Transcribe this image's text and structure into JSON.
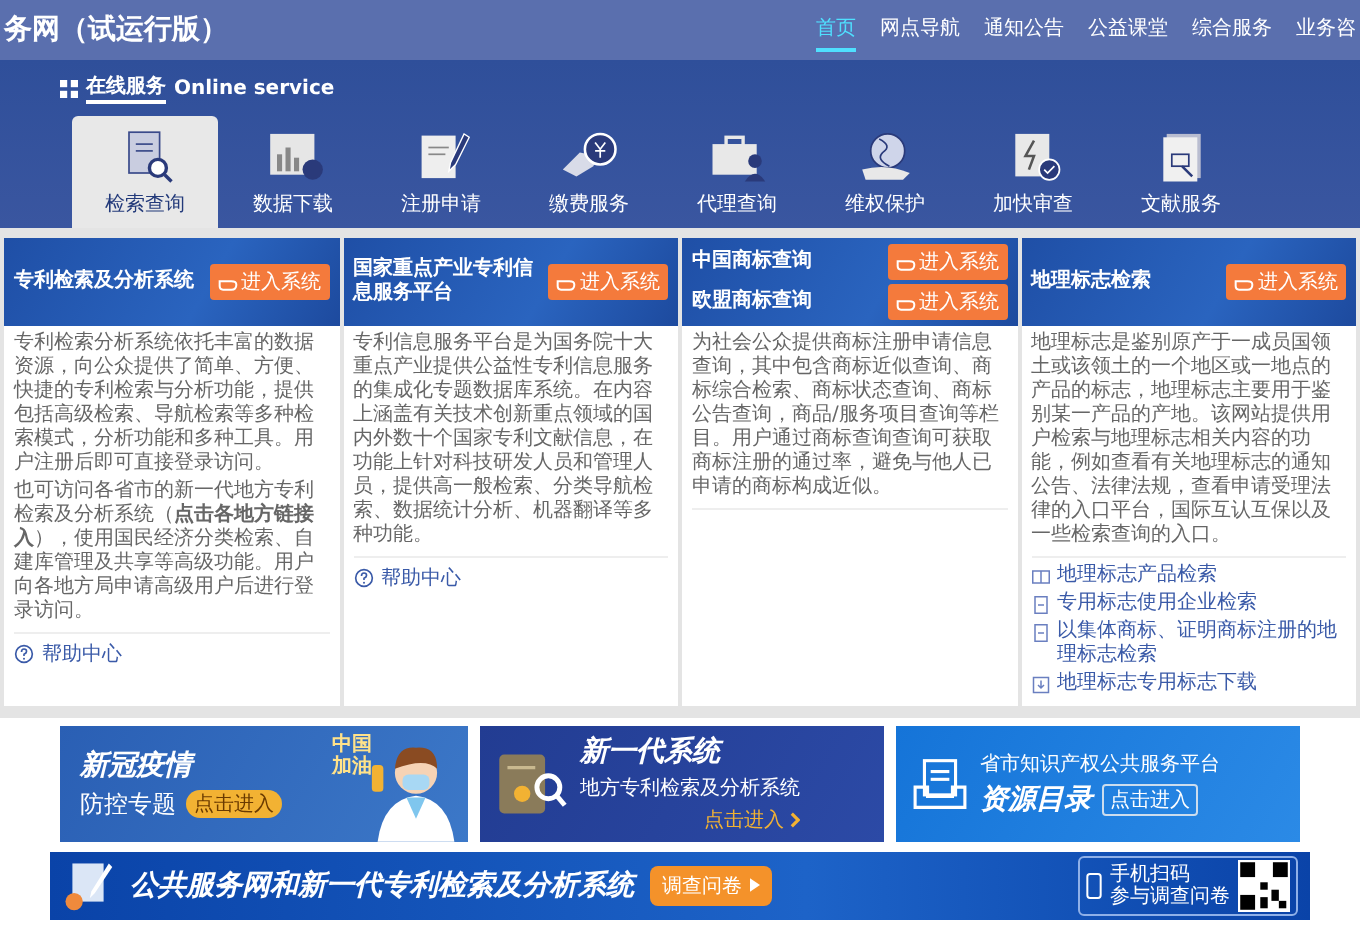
{
  "header": {
    "title": "务网（试运行版）",
    "nav": [
      {
        "label": "首页",
        "selected": true
      },
      {
        "label": "网点导航",
        "selected": false
      },
      {
        "label": "通知公告",
        "selected": false
      },
      {
        "label": "公益课堂",
        "selected": false
      },
      {
        "label": "综合服务",
        "selected": false
      },
      {
        "label": "业务咨",
        "selected": false
      }
    ]
  },
  "services": {
    "title": "在线服务",
    "subtitle": "Online service",
    "items": [
      {
        "label": "检索查询",
        "selected": true
      },
      {
        "label": "数据下载",
        "selected": false
      },
      {
        "label": "注册申请",
        "selected": false
      },
      {
        "label": "缴费服务",
        "selected": false
      },
      {
        "label": "代理查询",
        "selected": false
      },
      {
        "label": "维权保护",
        "selected": false
      },
      {
        "label": "加快审查",
        "selected": false
      },
      {
        "label": "文献服务",
        "selected": false
      }
    ]
  },
  "cards": [
    {
      "entries": [
        {
          "title": "专利检索及分析系统",
          "button": "进入系统"
        }
      ],
      "paragraphs": [
        "专利检索分析系统依托丰富的数据资源，向公众提供了简单、方便、快捷的专利检索与分析功能，提供包括高级检索、导航检索等多种检索模式，分析功能和多种工具。用户注册后即可直接登录访问。",
        "也可访问各省市的新一代地方专利检索及分析系统（**点击各地方链接入**），使用国民经济分类检索、自建库管理及共享等高级功能。用户向各地方局申请高级用户后进行登录访问。"
      ],
      "help": "帮助中心"
    },
    {
      "entries": [
        {
          "title": "国家重点产业专利信息服务平台",
          "button": "进入系统"
        }
      ],
      "paragraphs": [
        "专利信息服务平台是为国务院十大重点产业提供公益性专利信息服务的集成化专题数据库系统。在内容上涵盖有关技术创新重点领域的国内外数十个国家专利文献信息，在功能上针对科技研发人员和管理人员，提供高一般检索、分类导航检索、数据统计分析、机器翻译等多种功能。"
      ],
      "help": "帮助中心"
    },
    {
      "entries": [
        {
          "title": "中国商标查询",
          "button": "进入系统"
        },
        {
          "title": "欧盟商标查询",
          "button": "进入系统"
        }
      ],
      "paragraphs": [
        "为社会公众提供商标注册申请信息查询，其中包含商标近似查询、商标综合检索、商标状态查询、商标公告查询，商品/服务项目查询等栏目。用户通过商标查询查询可获取商标注册的通过率，避免与他人已申请的商标构成近似。"
      ]
    },
    {
      "entries": [
        {
          "title": "地理标志检索",
          "button": "进入系统"
        }
      ],
      "paragraphs": [
        "地理标志是鉴别原产于一成员国领土或该领土的一个地区或一地点的产品的标志，地理标志主要用于鉴别某一产品的产地。该网站提供用户检索与地理标志相关内容的功能，例如查看有关地理标志的通知公告、法律法规，查看申请受理法律的入口平台，国际互认互保以及一些检索查询的入口。"
      ],
      "links": [
        {
          "kind": "search",
          "label": "地理标志产品检索"
        },
        {
          "kind": "doc",
          "label": "专用标志使用企业检索"
        },
        {
          "kind": "doc",
          "label": "以集体商标、证明商标注册的地理标志检索"
        },
        {
          "kind": "download",
          "label": "地理标志专用标志下载"
        }
      ]
    }
  ],
  "banners": [
    {
      "kind": "epidemic",
      "title": "新冠疫情",
      "subtitle": "防控专题",
      "badge": "中国加油",
      "action": "点击进入"
    },
    {
      "kind": "system",
      "title": "新一代系统",
      "subtitle": "地方专利检索及分析系统",
      "action": "点击进入"
    },
    {
      "kind": "catalog",
      "title": "省市知识产权公共服务平台",
      "subtitle": "资源目录",
      "action": "点击进入"
    }
  ],
  "survey": {
    "title": "公共服务网和新一代专利检索及分析系统",
    "button": "调查问卷",
    "scan_lines": [
      "手机扫码",
      "参与调查问卷"
    ]
  }
}
